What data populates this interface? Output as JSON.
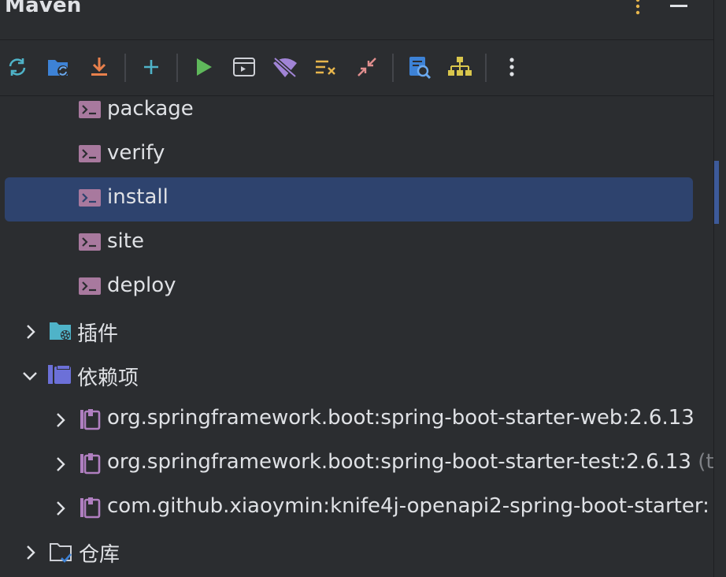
{
  "window": {
    "title": "Maven"
  },
  "header_buttons": [
    {
      "icon": "kebab-menu-icon"
    },
    {
      "icon": "minimize-icon"
    }
  ],
  "toolbar": {
    "buttons": [
      {
        "icon": "reload-icon"
      },
      {
        "icon": "generate-sources-icon"
      },
      {
        "icon": "download-icon"
      },
      {
        "icon": "add-icon"
      },
      {
        "icon": "run-icon"
      },
      {
        "icon": "execute-goal-icon"
      },
      {
        "icon": "toggle-offline-icon"
      },
      {
        "icon": "skip-tests-icon"
      },
      {
        "icon": "collapse-all-icon"
      },
      {
        "icon": "analyze-dependencies-icon"
      },
      {
        "icon": "show-diagram-icon"
      },
      {
        "icon": "more-options-icon"
      }
    ]
  },
  "lifecycle_goals": [
    {
      "label": "package"
    },
    {
      "label": "verify"
    },
    {
      "label": "install",
      "selected": true
    },
    {
      "label": "site"
    },
    {
      "label": "deploy"
    }
  ],
  "sections": {
    "plugins": {
      "label": "插件",
      "expanded": false
    },
    "dependencies": {
      "label": "依赖项",
      "expanded": true
    },
    "repositories": {
      "label": "仓库",
      "expanded": false
    }
  },
  "dependencies": [
    {
      "label": "org.springframework.boot:spring-boot-starter-web:2.6.13",
      "suffix": ""
    },
    {
      "label": "org.springframework.boot:spring-boot-starter-test:2.6.13",
      "suffix": "(te"
    },
    {
      "label": "com.github.xiaoymin:knife4j-openapi2-spring-boot-starter:",
      "suffix": ""
    }
  ],
  "colors": {
    "background": "#2b2d30",
    "selection": "#2e436e",
    "goal_icon": "#b07fc0",
    "dependency_icon": "#b07fc0",
    "run_green": "#5fb85b",
    "accent_blue": "#3d82d6"
  }
}
